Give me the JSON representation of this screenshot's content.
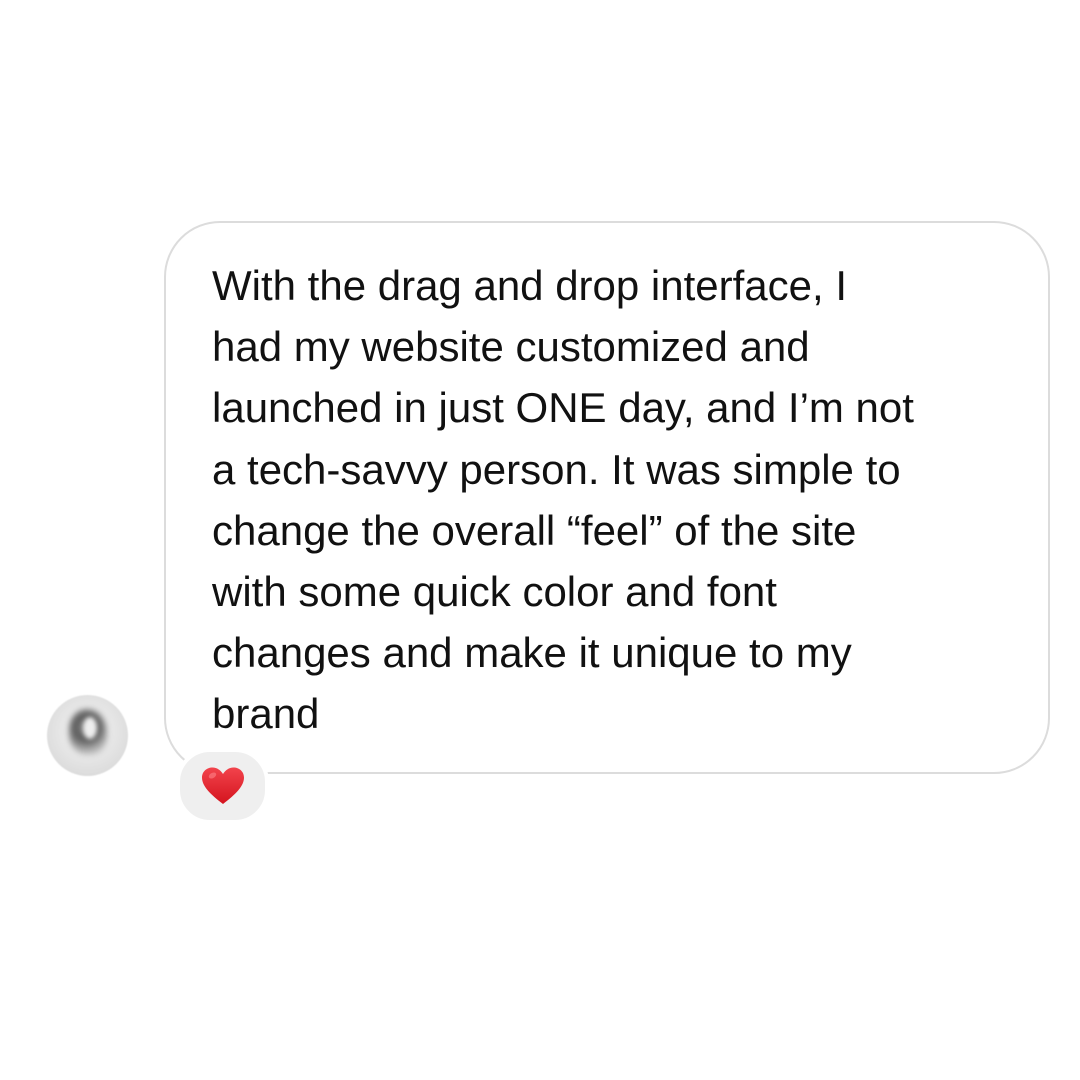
{
  "message": {
    "lines": [
      "With the drag and drop interface, I",
      "had my website customized and",
      "launched in just ONE day, and I’m not",
      "a tech-savvy person. It was simple to",
      "change the overall “feel” of the site",
      "with some quick color and font",
      "changes and make it unique to my",
      "brand"
    ]
  },
  "reaction": {
    "icon": "red-heart-icon",
    "color": "#e0202a"
  },
  "avatar": {
    "icon": "blurred-profile-photo"
  },
  "colors": {
    "background": "#ffffff",
    "bubble_border": "#dcdcdc",
    "reaction_background": "#efefef",
    "text": "#111111"
  }
}
